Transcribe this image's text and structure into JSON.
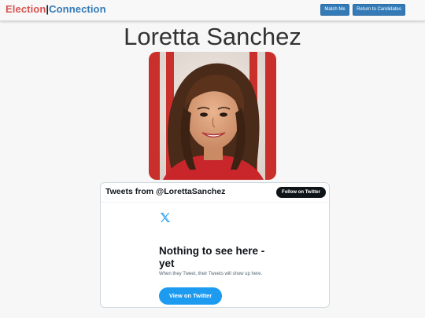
{
  "navbar": {
    "brand_part1": "Election",
    "brand_separator": "|",
    "brand_part2": "Connection",
    "match_button": "Match Me",
    "return_button": "Return to Candidates"
  },
  "candidate": {
    "name": "Loretta Sanchez"
  },
  "twitter": {
    "header_title": "Tweets from @LorettaSanchez",
    "follow_button": "Follow on Twitter",
    "logo_icon": "x-logo-icon",
    "empty_title": "Nothing to see here - yet",
    "empty_subtitle": "When they Tweet, their Tweets will show up here.",
    "view_button": "View on Twitter"
  },
  "colors": {
    "brand_red": "#d9534f",
    "brand_blue": "#337ab7",
    "twitter_blue": "#1d9bf0"
  }
}
